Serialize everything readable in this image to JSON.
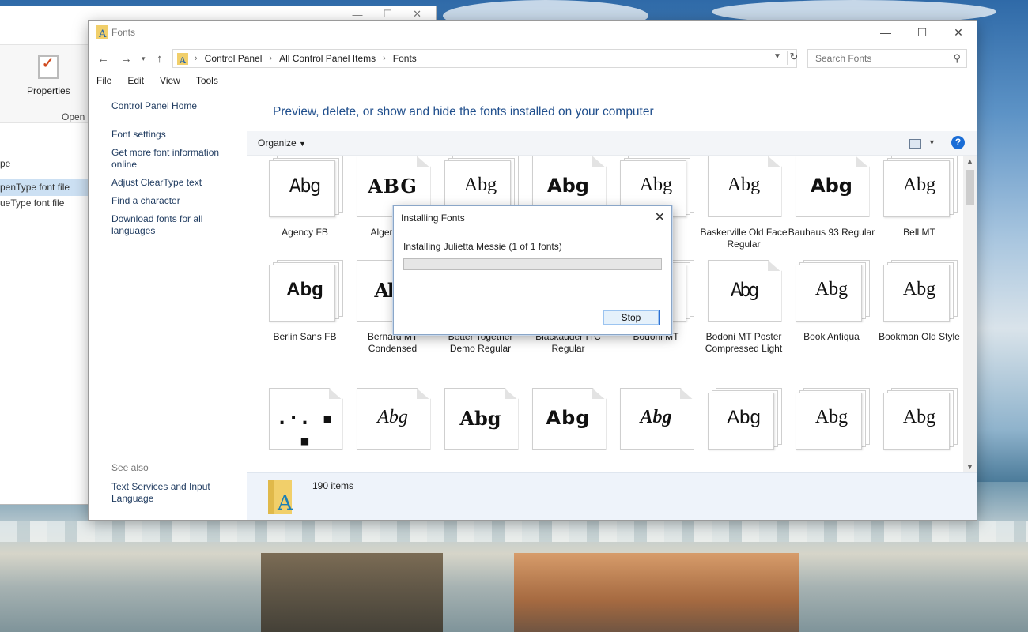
{
  "background_window": {
    "ribbon_properties": "Properties",
    "ribbon_open": "Open",
    "col_type": "pe",
    "rows": [
      "penType font file",
      "ueType font file"
    ]
  },
  "window": {
    "title": "Fonts",
    "controls": {
      "minimize": "—",
      "maximize": "☐",
      "close": "✕"
    }
  },
  "address": {
    "crumbs": [
      "Control Panel",
      "All Control Panel Items",
      "Fonts"
    ],
    "search_placeholder": "Search Fonts"
  },
  "menu": [
    "File",
    "Edit",
    "View",
    "Tools"
  ],
  "left_pane": {
    "links": [
      "Control Panel Home",
      "Font settings",
      "Get more font information online",
      "Adjust ClearType text",
      "Find a character",
      "Download fonts for all languages"
    ],
    "see_also": "See also",
    "see_also_links": [
      "Text Services and Input Language"
    ]
  },
  "heading": "Preview, delete, or show and hide the fonts installed on your computer",
  "toolbar": {
    "organize": "Organize",
    "help": "?"
  },
  "fonts": [
    {
      "name": "Agency FB",
      "sample": "Abg",
      "stacked": true
    },
    {
      "name": "Algerian R",
      "sample": "ABG",
      "stacked": false
    },
    {
      "name": "",
      "sample": "Abg",
      "stacked": true
    },
    {
      "name": "",
      "sample": "Abg",
      "stacked": false
    },
    {
      "name": "t",
      "sample": "Abg",
      "stacked": true
    },
    {
      "name": "Baskerville Old Face Regular",
      "sample": "Abg",
      "stacked": false
    },
    {
      "name": "Bauhaus 93 Regular",
      "sample": "Abg",
      "stacked": false
    },
    {
      "name": "Bell MT",
      "sample": "Abg",
      "stacked": true
    },
    {
      "name": "Berlin Sans FB",
      "sample": "Abg",
      "stacked": true
    },
    {
      "name": "Bernard MT Condensed",
      "sample": "Abg",
      "stacked": false
    },
    {
      "name": "Better Together Demo Regular",
      "sample": "",
      "stacked": false
    },
    {
      "name": "Blackadder ITC Regular",
      "sample": "",
      "stacked": false
    },
    {
      "name": "Bodoni MT",
      "sample": "",
      "stacked": true
    },
    {
      "name": "Bodoni MT Poster Compressed Light",
      "sample": "Abg",
      "stacked": false
    },
    {
      "name": "Book Antiqua",
      "sample": "Abg",
      "stacked": true
    },
    {
      "name": "Bookman Old Style",
      "sample": "Abg",
      "stacked": true
    },
    {
      "name": "",
      "sample": ".·.  ▪  ▪",
      "stacked": false
    },
    {
      "name": "",
      "sample": "Abg",
      "stacked": false
    },
    {
      "name": "",
      "sample": "Abg",
      "stacked": false
    },
    {
      "name": "",
      "sample": "Abg",
      "stacked": false
    },
    {
      "name": "",
      "sample": "Abg",
      "stacked": false
    },
    {
      "name": "",
      "sample": "Abg",
      "stacked": true
    },
    {
      "name": "",
      "sample": "Abg",
      "stacked": true
    },
    {
      "name": "",
      "sample": "Abg",
      "stacked": true
    }
  ],
  "status": {
    "count": "190 items"
  },
  "dialog": {
    "title": "Installing Fonts",
    "message": "Installing Julietta Messie (1 of 1 fonts)",
    "progress": 0,
    "stop": "Stop",
    "close": "✕"
  },
  "colors": {
    "link": "#1e3a5f",
    "heading": "#1f4e8c",
    "progress": "#06b025",
    "help": "#1a6dd6"
  }
}
